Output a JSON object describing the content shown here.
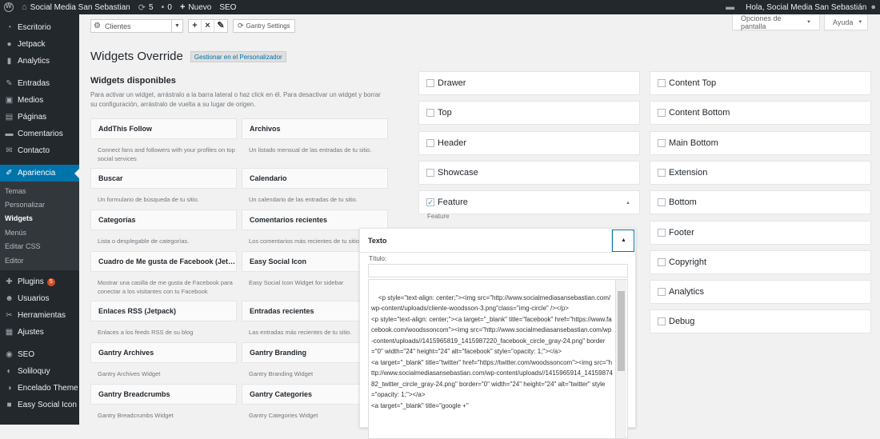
{
  "adminbar": {
    "site_name": "Social Media San Sebastian",
    "updates_count": "5",
    "comments_count": "0",
    "new_label": "Nuevo",
    "seo_label": "SEO",
    "greeting": "Hola, Social Media San Sebastián"
  },
  "menu": {
    "items_top": [
      {
        "label": "Escritorio",
        "icon": "dashboard-icon"
      },
      {
        "label": "Jetpack",
        "icon": "jetpack-icon"
      },
      {
        "label": "Analytics",
        "icon": "analytics-icon"
      }
    ],
    "items_mid": [
      {
        "label": "Entradas",
        "icon": "pin-icon"
      },
      {
        "label": "Medios",
        "icon": "media-icon"
      },
      {
        "label": "Páginas",
        "icon": "pages-icon"
      },
      {
        "label": "Comentarios",
        "icon": "comments-icon"
      },
      {
        "label": "Contacto",
        "icon": "contact-icon"
      }
    ],
    "active": {
      "label": "Apariencia",
      "icon": "appearance-icon"
    },
    "submenu": [
      "Temas",
      "Personalizar",
      "Widgets",
      "Menús",
      "Editar CSS",
      "Editor"
    ],
    "items_bottom": [
      {
        "label": "Plugins",
        "icon": "plugins-icon",
        "badge": "5"
      },
      {
        "label": "Usuarios",
        "icon": "users-icon"
      },
      {
        "label": "Herramientas",
        "icon": "tools-icon"
      },
      {
        "label": "Ajustes",
        "icon": "settings-icon"
      }
    ],
    "items_extra": [
      {
        "label": "SEO",
        "icon": "seo-icon"
      },
      {
        "label": "Soliloquy",
        "icon": "soliloquy-icon"
      },
      {
        "label": "Enceladо Theme",
        "icon": "theme-icon"
      },
      {
        "label": "Easy Social Icon",
        "icon": "social-icon"
      }
    ]
  },
  "toolbar": {
    "override_select": "Clientes",
    "gantry_settings": "Gantry Settings"
  },
  "screen_options": "Opciones de pantalla",
  "help": "Ayuda",
  "page": {
    "title": "Widgets Override",
    "action": "Gestionar en el Personalizador",
    "available_heading": "Widgets disponibles",
    "available_desc": "Para activar un widget, arrástralo a la barra lateral o haz click en él. Para desactivar un widget y borrar su configuración, arrástralo de vuelta a su lugar de origen."
  },
  "widgets": [
    {
      "name": "AddThis Follow",
      "desc": "Connect fans and followers with your profiles on top social services"
    },
    {
      "name": "Archivos",
      "desc": "Un listado mensual de las entradas de tu sitio."
    },
    {
      "name": "Buscar",
      "desc": "Un formulario de búsqueda de tu sitio."
    },
    {
      "name": "Calendario",
      "desc": "Un calendario de las entradas de tu sitio."
    },
    {
      "name": "Categorías",
      "desc": "Lista o desplegable de categorías."
    },
    {
      "name": "Comentarios recientes",
      "desc": "Los comentarios más recientes de tu sitio."
    },
    {
      "name": "Cuadro de Me gusta de Facebook (Jetpack)",
      "desc": "Mostrar una casilla de me gusta de Facebook para conectar a los visitantes con tu Facebook"
    },
    {
      "name": "Easy Social Icon",
      "desc": "Easy Social Icon Widget for sidebar"
    },
    {
      "name": "Enlaces RSS (Jetpack)",
      "desc": "Enlaces a los feeds RSS de su blog"
    },
    {
      "name": "Entradas recientes",
      "desc": "Las entradas más recientes de tu sitio."
    },
    {
      "name": "Gantry Archives",
      "desc": "Gantry Archives Widget"
    },
    {
      "name": "Gantry Branding",
      "desc": "Gantry Branding Widget"
    },
    {
      "name": "Gantry Breadcrumbs",
      "desc": "Gantry Breadcrumbs Widget"
    },
    {
      "name": "Gantry Categories",
      "desc": "Gantry Categories Widget"
    }
  ],
  "areas_left": [
    {
      "name": "Drawer",
      "checked": false
    },
    {
      "name": "Top",
      "checked": false
    },
    {
      "name": "Header",
      "checked": false
    },
    {
      "name": "Showcase",
      "checked": false
    },
    {
      "name": "Feature",
      "checked": true,
      "desc": "Feature"
    }
  ],
  "areas_right": [
    {
      "name": "Content Top",
      "checked": false
    },
    {
      "name": "Content Bottom",
      "checked": false
    },
    {
      "name": "Main Bottom",
      "checked": false
    },
    {
      "name": "Extension",
      "checked": false
    },
    {
      "name": "Bottom",
      "checked": false
    },
    {
      "name": "Footer",
      "checked": false
    },
    {
      "name": "Copyright",
      "checked": false
    },
    {
      "name": "Analytics",
      "checked": false
    },
    {
      "name": "Debug",
      "checked": false
    }
  ],
  "text_widget": {
    "header": "Texto",
    "title_label": "Título:",
    "title_value": "",
    "content": "<p style=\"text-align: center;\"><img src=\"http://www.socialmediasansebastian.com/wp-content/uploads/cliente-woodsson-3.png\"class=\"img-circle\" /></p>\n<p style=\"text-align: center;\"><a target=\"_blank\" title=\"facebook\" href=\"https://www.facebook.com/woodssoncom\"><img src=\"http://www.socialmediasansebastian.com/wp-content/uploads//1415965819_1415987220_facebook_circle_gray-24.png\" border=\"0\" width=\"24\" height=\"24\" alt=\"facebook\" style=\"opacity: 1;\"></a>\n<a target=\"_blank\" title=\"twitter\" href=\"https://twitter.com/woodssoncom\"><img src=\"http://www.socialmediasansebastian.com/wp-content/uploads//1415965914_1415987482_twitter_circle_gray-24.png\" border=\"0\" width=\"24\" height=\"24\" alt=\"twitter\" style=\"opacity: 1;\"></a>\n<a target=\"_blank\" title=\"google +\""
  },
  "colors": {
    "adminbar": "#23282d",
    "accent": "#0073aa",
    "badge": "#d54e21"
  }
}
